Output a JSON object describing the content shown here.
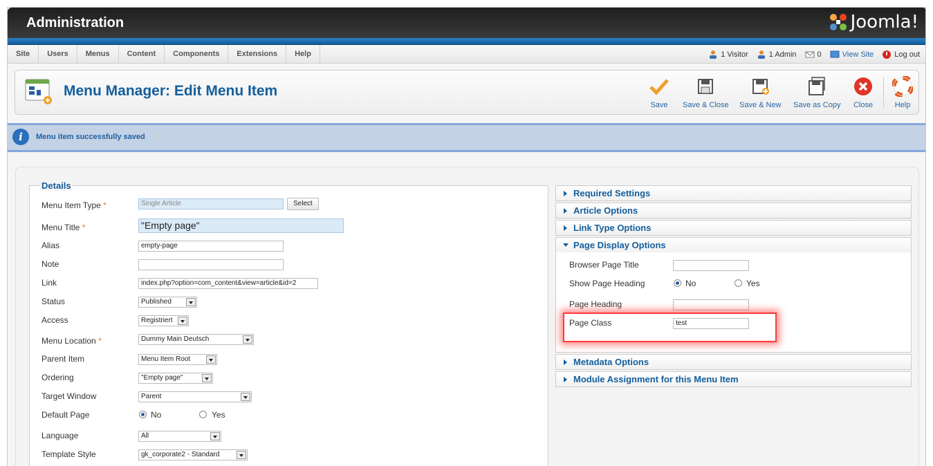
{
  "header": {
    "title": "Administration",
    "logo_text": "Joomla!"
  },
  "menu": [
    "Site",
    "Users",
    "Menus",
    "Content",
    "Components",
    "Extensions",
    "Help"
  ],
  "status": {
    "visitors": "1 Visitor",
    "admins": "1 Admin",
    "messages": "0",
    "view_site": "View Site",
    "logout": "Log out"
  },
  "page_title": "Menu Manager: Edit Menu Item",
  "toolbar": {
    "save": "Save",
    "save_close": "Save & Close",
    "save_new": "Save & New",
    "save_copy": "Save as Copy",
    "close": "Close",
    "help": "Help"
  },
  "message": "Menu item successfully saved",
  "details": {
    "legend": "Details",
    "required_marker": "*",
    "menu_item_type": {
      "label": "Menu Item Type",
      "value": "Single Article",
      "button": "Select"
    },
    "menu_title": {
      "label": "Menu Title",
      "value": "\"Empty page\""
    },
    "alias": {
      "label": "Alias",
      "value": "empty-page"
    },
    "note": {
      "label": "Note",
      "value": ""
    },
    "link": {
      "label": "Link",
      "value": "index.php?option=com_content&view=article&id=2"
    },
    "status": {
      "label": "Status",
      "value": "Published"
    },
    "access": {
      "label": "Access",
      "value": "Registriert"
    },
    "menu_location": {
      "label": "Menu Location",
      "value": "Dummy Main Deutsch"
    },
    "parent_item": {
      "label": "Parent Item",
      "value": "Menu Item Root"
    },
    "ordering": {
      "label": "Ordering",
      "value": "\"Empty page\""
    },
    "target_window": {
      "label": "Target Window",
      "value": "Parent"
    },
    "default_page": {
      "label": "Default Page",
      "no": "No",
      "yes": "Yes",
      "selected": "No"
    },
    "language": {
      "label": "Language",
      "value": "All"
    },
    "template_style": {
      "label": "Template Style",
      "value": "gk_corporate2 - Standard"
    }
  },
  "panels": {
    "required_settings": "Required Settings",
    "article_options": "Article Options",
    "link_type_options": "Link Type Options",
    "page_display_options": "Page Display Options",
    "metadata_options": "Metadata Options",
    "module_assignment": "Module Assignment for this Menu Item"
  },
  "page_display": {
    "browser_page_title": {
      "label": "Browser Page Title",
      "value": ""
    },
    "show_page_heading": {
      "label": "Show Page Heading",
      "no": "No",
      "yes": "Yes",
      "selected": "No"
    },
    "page_heading": {
      "label": "Page Heading",
      "value": ""
    },
    "page_class": {
      "label": "Page Class",
      "value": "test"
    }
  }
}
